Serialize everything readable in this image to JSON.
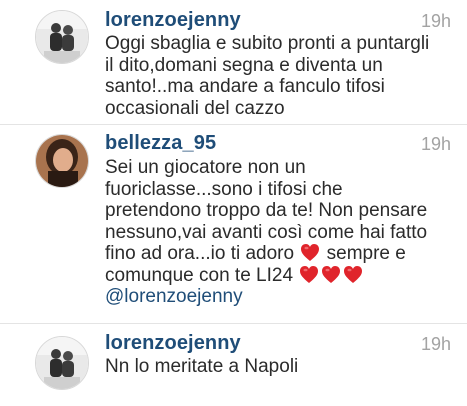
{
  "comments": [
    {
      "username": "lorenzoejenny",
      "time": "19h",
      "lines": [
        "Oggi sbaglia e subito pronti a puntargli",
        "il dito,domani segna e diventa un",
        "santo!..ma andare a fanculo tifosi",
        "occasionali del cazzo"
      ]
    },
    {
      "username": "bellezza_95",
      "time": "19h",
      "lines": [
        "Sei un giocatore non un",
        "fuoriclasse...sono i tifosi che",
        "pretendono troppo da te! Non pensare",
        "nessuno,vai avanti così come hai fatto"
      ],
      "line5_text": "fino ad ora...io ti adoro",
      "line5_after": "sempre e",
      "line6_text": "comunque con te LI24",
      "mention": "@lorenzoejenny"
    },
    {
      "username": "lorenzoejenny",
      "time": "19h",
      "lines": [
        "Nn lo meritate a Napoli"
      ]
    }
  ],
  "icons": {
    "heart": "red-heart-emoji",
    "heart_color": "#e0242b"
  },
  "colors": {
    "username": "#1f4d78",
    "timestamp": "#a3a3a3",
    "divider": "#e4e4e4"
  }
}
